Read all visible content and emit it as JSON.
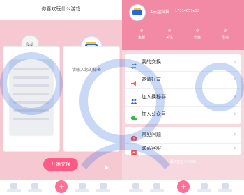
{
  "left_screen": {
    "title": "你喜欢玩什么游戏",
    "textarea_placeholder": "请输入您的秘密",
    "start_button": "开始交换"
  },
  "right_screen": {
    "brand_name": "A云起科技",
    "brand_id": "17554657e53",
    "stats": [
      {
        "value": "0",
        "label": "金额"
      },
      {
        "value": "0",
        "label": "关注"
      },
      {
        "value": "0",
        "label": "粉丝"
      },
      {
        "value": "9",
        "label": "足迹"
      }
    ],
    "menu_primary": [
      {
        "label": "我的交换",
        "icon": "swap-icon"
      },
      {
        "label": "邀请好友",
        "icon": "megaphone-icon"
      },
      {
        "label": "加入换秘群",
        "icon": "group-icon"
      },
      {
        "label": "加入公众号",
        "icon": "wechat-icon"
      }
    ],
    "menu_secondary": [
      {
        "label": "常见问题",
        "icon": "warning-icon"
      },
      {
        "label": "联系客服",
        "icon": "contact-icon"
      }
    ],
    "copyright": "版权信息©2020"
  },
  "colors": {
    "pink_header": "#f38aa5",
    "pink_background": "#f7d8df",
    "accent_button": "#ff5a86"
  }
}
